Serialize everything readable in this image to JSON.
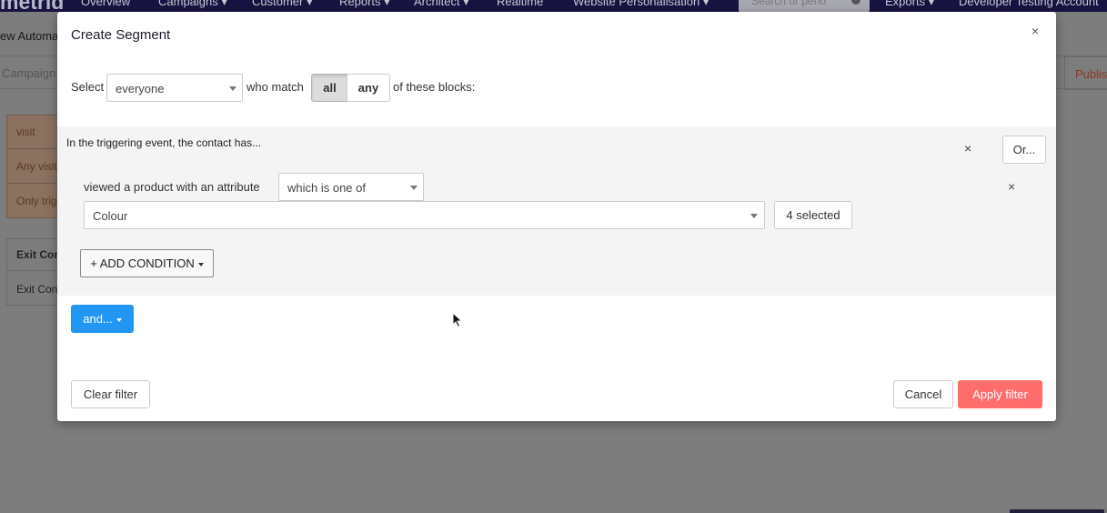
{
  "background": {
    "logo": "metrid",
    "nav": [
      "Overview",
      "Campaigns ▾",
      "Customer ▾",
      "Reports ▾",
      "Architect ▾",
      "Realtime",
      "Website Personalisation ▾",
      "Exports ▾",
      "Developer Testing Account"
    ],
    "search_placeholder": "Search or perio",
    "page_title": "ew Automa",
    "tab_label": "Campaign",
    "publish_label": "Publis",
    "card_items": [
      "visit",
      "Any visit",
      "Only trig"
    ],
    "exit_items": [
      "Exit Con",
      "Exit Con"
    ]
  },
  "modal": {
    "title": "Create Segment",
    "close_glyph": "×",
    "select_label": "Select",
    "audience_value": "everyone",
    "who_match_label": "who match",
    "match_options": [
      "all",
      "any"
    ],
    "match_selected": "all",
    "blocks_label": "of these blocks:",
    "block": {
      "title": "In the triggering event, the contact has...",
      "remove_glyph": "×",
      "or_label": "Or...",
      "condition": {
        "text": "viewed a product with an attribute",
        "operator_value": "which is one of",
        "attribute_value": "Colour",
        "selected_label": "4 selected",
        "remove_glyph": "×"
      },
      "add_condition_label": "+ ADD CONDITION"
    },
    "and_label": "and...",
    "clear_filter_label": "Clear filter",
    "cancel_label": "Cancel",
    "apply_label": "Apply filter"
  },
  "colors": {
    "primary": "#2196f3",
    "apply": "#ff6d6d",
    "nav_bg": "#171442"
  }
}
